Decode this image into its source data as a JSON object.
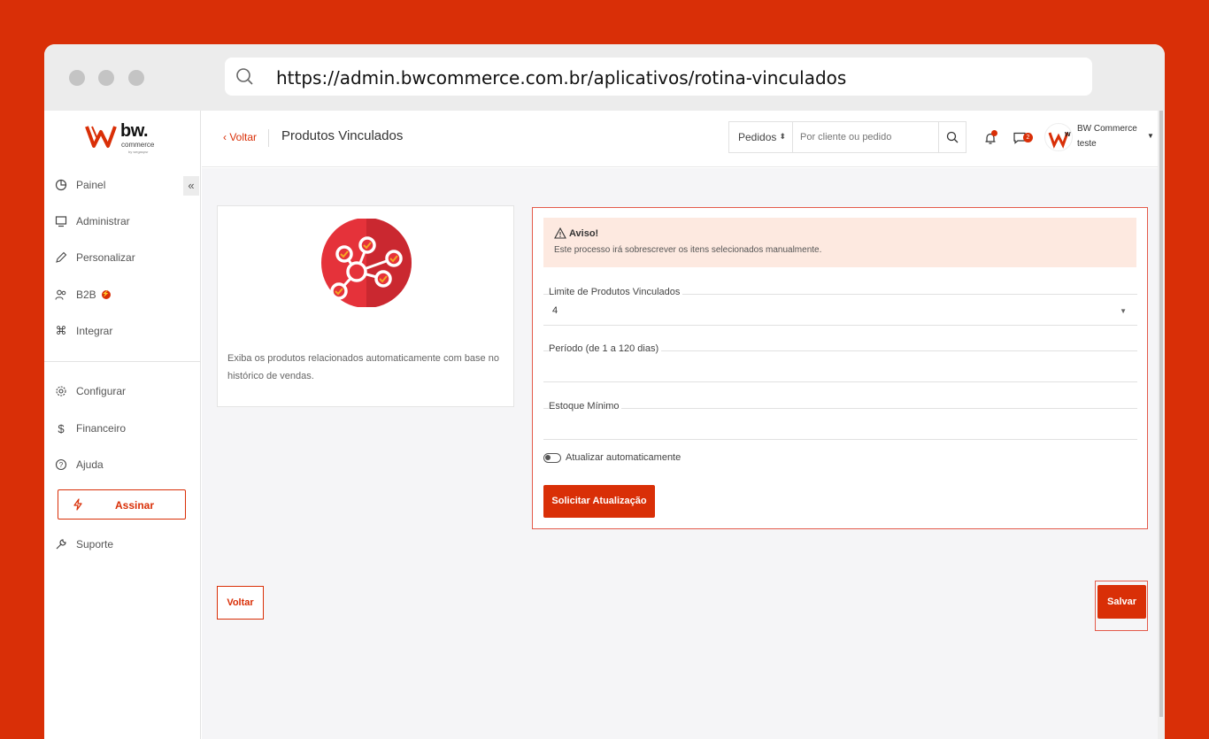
{
  "browser": {
    "url": "https://admin.bwcommerce.com.br/aplicativos/rotina-vinculados"
  },
  "logo": {
    "brand": "bw.",
    "sub": "commerce",
    "by": "by wegaspsr"
  },
  "sidebar": {
    "items": [
      {
        "label": "Painel",
        "icon": "pie-chart-icon"
      },
      {
        "label": "Administrar",
        "icon": "monitor-icon"
      },
      {
        "label": "Personalizar",
        "icon": "pencil-icon"
      },
      {
        "label": "B2B",
        "icon": "users-icon"
      },
      {
        "label": "Integrar",
        "icon": "command-icon"
      },
      {
        "label": "Configurar",
        "icon": "gear-icon"
      },
      {
        "label": "Financeiro",
        "icon": "dollar-icon"
      },
      {
        "label": "Ajuda",
        "icon": "help-icon"
      }
    ],
    "assinar_label": "Assinar",
    "suporte_label": "Suporte"
  },
  "header": {
    "back_label": "Voltar",
    "title": "Produtos Vinculados",
    "search_scope": "Pedidos",
    "search_placeholder": "Por cliente ou pedido",
    "chat_count": "2",
    "user_name": "BW Commerce",
    "user_sub": "teste"
  },
  "app_card": {
    "description": "Exiba os produtos relacionados automaticamente com base no histórico de vendas."
  },
  "form": {
    "warning_title": "Aviso!",
    "warning_text": "Este processo irá sobrescrever os itens selecionados manualmente.",
    "limit_label": "Limite de Produtos Vinculados",
    "limit_value": "4",
    "period_label": "Período (de 1 a 120 dias)",
    "period_value": "",
    "stock_label": "Estoque Mínimo",
    "stock_value": "",
    "auto_update_label": "Atualizar automaticamente",
    "auto_update_on": false,
    "request_label": "Solicitar Atualização"
  },
  "footer": {
    "back_label": "Voltar",
    "save_label": "Salvar"
  },
  "colors": {
    "accent": "#d92f07",
    "warning_bg": "#fde9e0"
  }
}
